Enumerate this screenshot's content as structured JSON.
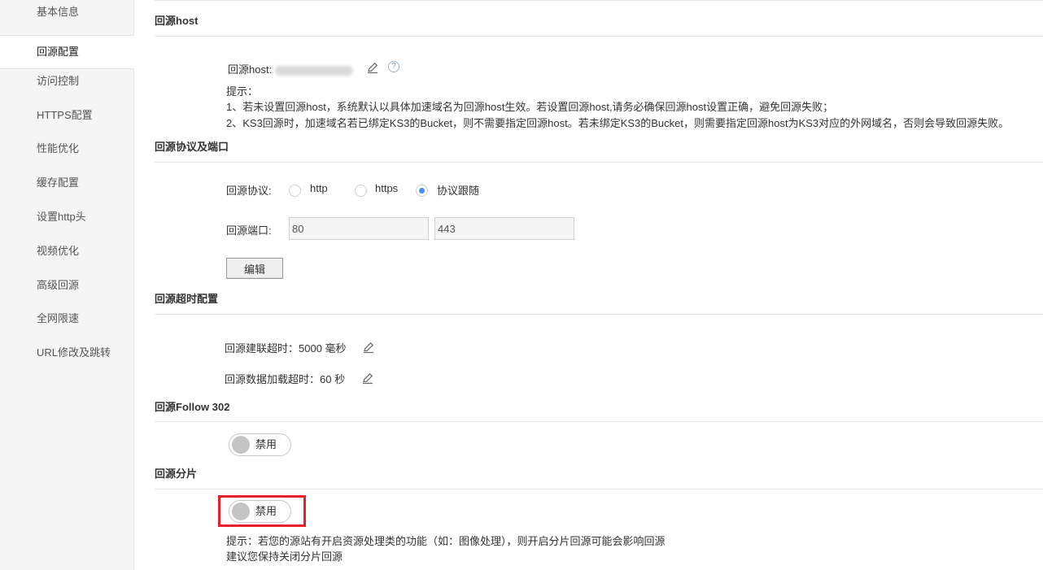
{
  "sidebar": {
    "items": [
      {
        "label": "基本信息"
      },
      {
        "label": "回源配置"
      },
      {
        "label": "访问控制"
      },
      {
        "label": "HTTPS配置"
      },
      {
        "label": "性能优化"
      },
      {
        "label": "缓存配置"
      },
      {
        "label": "设置http头"
      },
      {
        "label": "视频优化"
      },
      {
        "label": "高级回源"
      },
      {
        "label": "全网限速"
      },
      {
        "label": "URL修改及跳转"
      }
    ],
    "active": "回源配置"
  },
  "host_section": {
    "title": "回源host",
    "field_label": "回源host:",
    "hint_title": "提示：",
    "hint_1": "1、若未设置回源host，系统默认以具体加速域名为回源host生效。若设置回源host,请务必确保回源host设置正确，避免回源失败；",
    "hint_2": "2、KS3回源时，加速域名若已绑定KS3的Bucket，则不需要指定回源host。若未绑定KS3的Bucket，则需要指定回源host为KS3对应的外网域名，否则会导致回源失败。",
    "help_glyph": "?"
  },
  "protocol_section": {
    "title": "回源协议及端口",
    "protocol_label": "回源协议:",
    "options": [
      {
        "label": "http",
        "checked": false
      },
      {
        "label": "https",
        "checked": false
      },
      {
        "label": "协议跟随",
        "checked": true
      }
    ],
    "port_label": "回源端口:",
    "http_port": "80",
    "https_port": "443",
    "edit_button": "编辑"
  },
  "timeout_section": {
    "title": "回源超时配置",
    "connect_label": "回源建联超时：",
    "connect_value": "5000 毫秒",
    "load_label": "回源数据加载超时：",
    "load_value": "60 秒"
  },
  "follow_section": {
    "title": "回源Follow 302",
    "toggle_label": "禁用",
    "enabled": false
  },
  "range_section": {
    "title": "回源分片",
    "toggle_label": "禁用",
    "enabled": false,
    "hint_1": "提示：若您的源站有开启资源处理类的功能（如：图像处理），则开启分片回源可能会影响回源",
    "hint_2": "建议您保持关闭分片回源"
  },
  "colors": {
    "accent": "#4a8ef0",
    "highlight": "#e8202a",
    "sidebar_bg": "#f5f5f5"
  }
}
